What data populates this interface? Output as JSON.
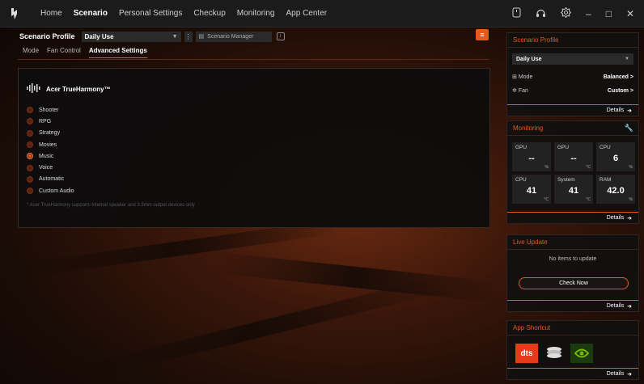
{
  "nav": {
    "items": [
      "Home",
      "Scenario",
      "Personal Settings",
      "Checkup",
      "Monitoring",
      "App Center"
    ],
    "active_index": 1
  },
  "top_icons": [
    "keyboard-icon",
    "headset-icon",
    "settings-icon",
    "minimize-icon",
    "maximize-icon",
    "close-icon"
  ],
  "profile": {
    "label": "Scenario Profile",
    "selected": "Daily Use",
    "manager_label": "Scenario Manager"
  },
  "subtabs": {
    "items": [
      "Mode",
      "Fan Control",
      "Advanced Settings"
    ],
    "active_index": 2
  },
  "panel": {
    "title": "Acer TrueHarmony™",
    "options": [
      "Shooter",
      "RPG",
      "Strategy",
      "Movies",
      "Music",
      "Voice",
      "Automatic",
      "Custom Audio"
    ],
    "selected_index": 4,
    "footnote": "* Acer TrueHarmony supports internal speaker and 3.5mm output devices only"
  },
  "side": {
    "scenario_profile": {
      "title": "Scenario Profile",
      "selected": "Daily Use",
      "mode_label": "Mode",
      "mode_value": "Balanced",
      "fan_label": "Fan",
      "fan_value": "Custom",
      "details": "Details"
    },
    "monitoring": {
      "title": "Monitoring",
      "cells": [
        {
          "name": "GPU",
          "value": "--",
          "unit": "%"
        },
        {
          "name": "GPU",
          "value": "--",
          "unit": "°C"
        },
        {
          "name": "CPU",
          "value": "6",
          "unit": "%"
        },
        {
          "name": "CPU",
          "value": "41",
          "unit": "°C"
        },
        {
          "name": "System",
          "value": "41",
          "unit": "°C"
        },
        {
          "name": "RAM",
          "value": "42.0",
          "unit": "%"
        }
      ],
      "details": "Details"
    },
    "live_update": {
      "title": "Live Update",
      "empty_text": "No items to update",
      "button": "Check Now",
      "details": "Details"
    },
    "app_shortcut": {
      "title": "App Shortcut",
      "apps": [
        "dts",
        "coin-stack-app",
        "nvidia"
      ],
      "dts_label": "dts",
      "details": "Details"
    }
  },
  "colors": {
    "accent": "#e55a1c",
    "topbar": "#1b1b1b",
    "panel": "#0e0c0c"
  }
}
